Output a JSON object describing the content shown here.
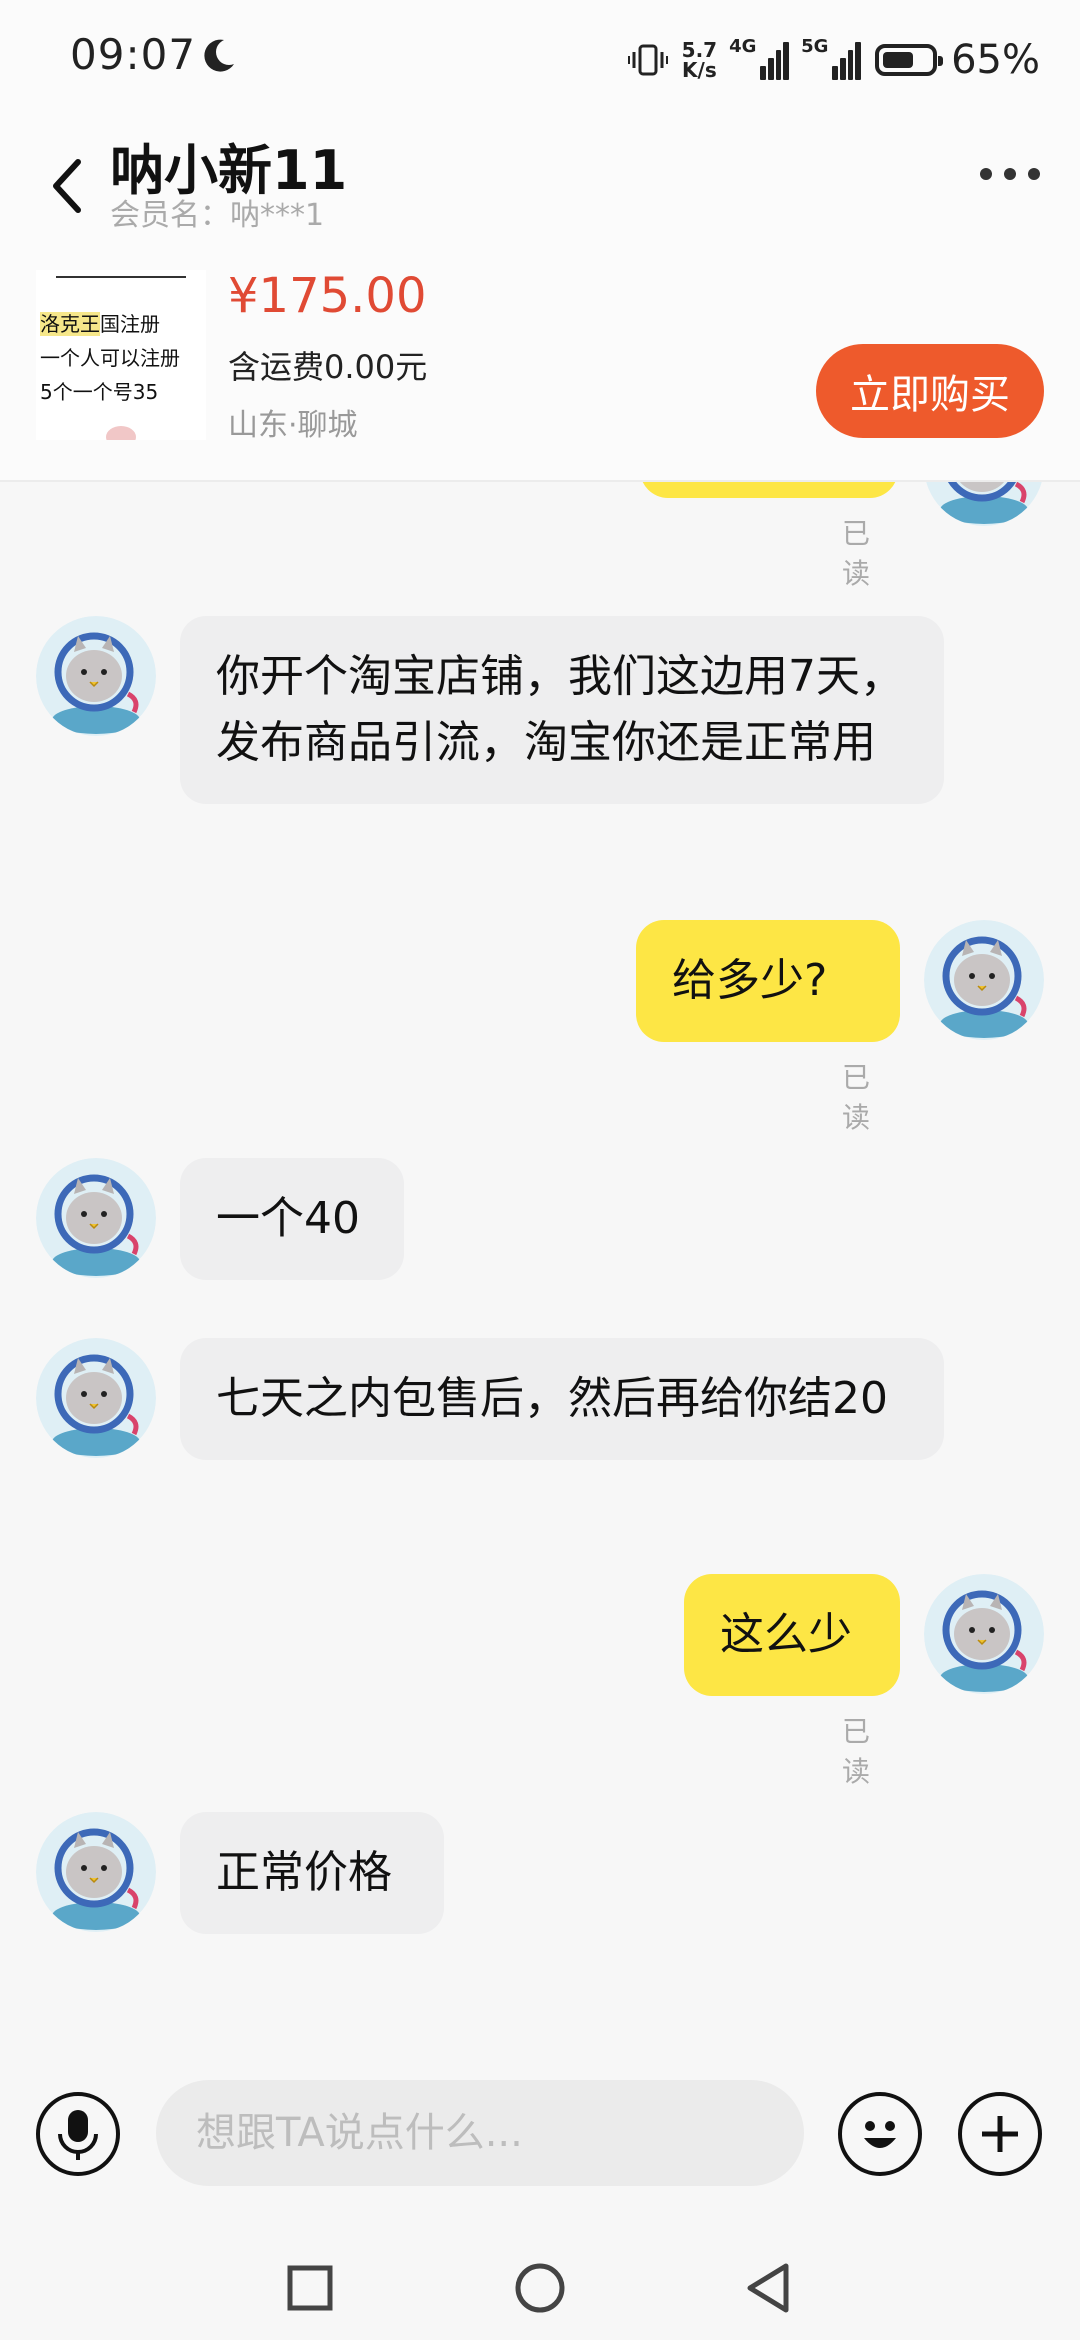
{
  "status_bar": {
    "time": "09:07",
    "net_speed_top": "5.7",
    "net_speed_bottom": "K/s",
    "sig1_label": "4G",
    "sig2_label": "5G",
    "battery": "65%",
    "battery_level": 0.65
  },
  "header": {
    "title": "呐小新11",
    "member_label": "会员名：",
    "member_value": "呐***1",
    "more_icon": "more-dots-icon",
    "back_icon": "chevron-left-icon"
  },
  "product": {
    "thumb_lines": [
      "洛克王",
      "国注册",
      "一个人可以注册",
      "5个一个号35"
    ],
    "price": "¥175.00",
    "shipping": "含运费0.00元",
    "location": "山东·聊城",
    "buy_label": "立即购买"
  },
  "messages": [
    {
      "side": "right",
      "text": "",
      "read": "已读"
    },
    {
      "side": "left",
      "text": "你开个淘宝店铺，我们这边用7天，发布商品引流，淘宝你还是正常用"
    },
    {
      "side": "right",
      "text": "给多少?",
      "read": "已读"
    },
    {
      "side": "left",
      "text": "一个40"
    },
    {
      "side": "left",
      "text": "七天之内包售后，然后再给你结20"
    },
    {
      "side": "right",
      "text": "这么少",
      "read": "已读"
    },
    {
      "side": "left",
      "text": "正常价格"
    }
  ],
  "input": {
    "placeholder": "想跟TA说点什么..."
  },
  "colors": {
    "accent_orange": "#ee5a2c",
    "price_red": "#e04a34",
    "bubble_out": "#fde645",
    "bubble_in": "#eeeeef"
  }
}
